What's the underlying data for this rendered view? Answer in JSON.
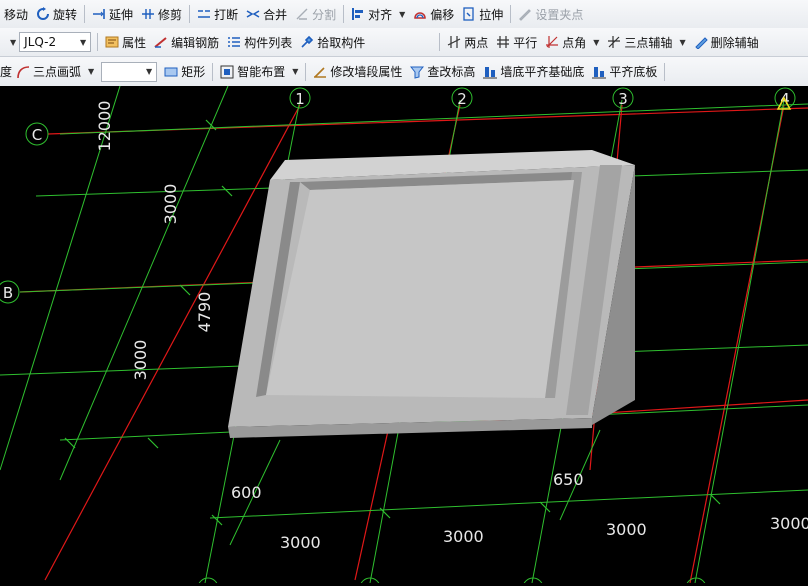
{
  "toolbar1": {
    "move": "移动",
    "rotate": "旋转",
    "extend": "延伸",
    "trim": "修剪",
    "break": "打断",
    "merge": "合并",
    "split": "分割",
    "align": "对齐",
    "offset": "偏移",
    "stretch": "拉伸",
    "set_grip": "设置夹点"
  },
  "toolbar2": {
    "component": "JLQ-2",
    "properties": "属性",
    "edit_rebar": "编辑钢筋",
    "component_list": "构件列表",
    "pick_component": "拾取构件",
    "two_point": "两点",
    "parallel": "平行",
    "point_angle": "点角",
    "three_point_aux": "三点辅轴",
    "delete_aux": "删除辅轴"
  },
  "toolbar3": {
    "left_partial": "度",
    "arc_mode": "三点画弧",
    "rectangle": "矩形",
    "smart_layout": "智能布置",
    "modify_wall_segment": "修改墙段属性",
    "check_elevation": "查改标高",
    "align_wall_bottom": "墙底平齐基础底",
    "align_slab_bottom": "平齐底板"
  },
  "axes": {
    "col1": "1",
    "col2": "2",
    "col3": "3",
    "col4": "4",
    "rowC": "C",
    "rowB": "B"
  },
  "dimensions": {
    "d12000": "12000",
    "d3000_top": "3000",
    "d4790": "4790",
    "d3000_left": "3000",
    "d600": "600",
    "d650": "650",
    "d3000_b1": "3000",
    "d3000_b2": "3000",
    "d3000_b3": "3000",
    "d3000_b4": "3000"
  },
  "colors": {
    "grid_green": "#2fbf2f",
    "axis_red": "#e01818",
    "model_gray": "#bcbcbc",
    "selection_yellow": "#f0e020"
  }
}
